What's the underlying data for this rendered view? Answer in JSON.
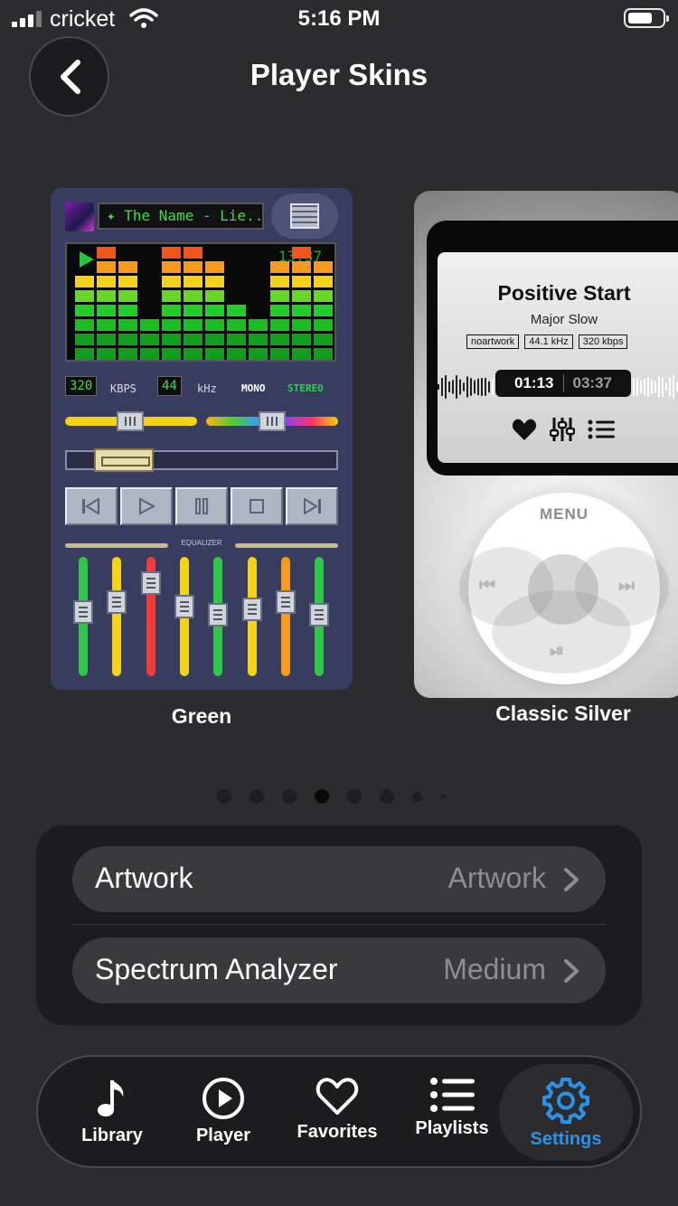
{
  "status_bar": {
    "carrier": "cricket",
    "time": "5:16 PM"
  },
  "header": {
    "title": "Player Skins"
  },
  "skins": [
    {
      "label": "Green",
      "track_display": "✦ The Name - Lie...",
      "time": "13:37",
      "bitrate": "320",
      "bitrate_unit": "KBPS",
      "sample_rate": "44",
      "sample_unit": "kHz",
      "mono_label": "MONO",
      "stereo_label": "STEREO",
      "equalizer_label": "EQUALIZER",
      "spectrum_levels": [
        6,
        8,
        7,
        3,
        8,
        8,
        7,
        4,
        3,
        7,
        8,
        7
      ],
      "volume": 0.32,
      "balance": 0.5,
      "seek": 0.15,
      "eq_levels": [
        0.55,
        0.65,
        0.85,
        0.6,
        0.52,
        0.58,
        0.65,
        0.52
      ],
      "eq_colors": [
        "#2fc64a",
        "#f5d21a",
        "#ef3b3b",
        "#f5d21a",
        "#2fc64a",
        "#f5d21a",
        "#f79a1d",
        "#2fc64a"
      ],
      "transport": [
        "prev",
        "play",
        "pause",
        "stop",
        "next"
      ]
    },
    {
      "label": "Classic Silver",
      "track_title": "Positive Start",
      "artist": "Major Slow",
      "tags": [
        "noartwork",
        "44.1 kHz",
        "320 kbps"
      ],
      "current_time": "01:13",
      "total_time": "03:37",
      "menu_label": "MENU",
      "icons": [
        "heart-icon",
        "equalizer-icon",
        "list-icon"
      ]
    }
  ],
  "pager": {
    "count": 8,
    "active_index": 3
  },
  "settings": [
    {
      "label": "Artwork",
      "value": "Artwork"
    },
    {
      "label": "Spectrum Analyzer",
      "value": "Medium"
    }
  ],
  "tabbar": {
    "active_color": "#2a93e8",
    "tabs": [
      {
        "label": "Library",
        "icon": "music-note-icon"
      },
      {
        "label": "Player",
        "icon": "play-circle-icon"
      },
      {
        "label": "Favorites",
        "icon": "heart-icon"
      },
      {
        "label": "Playlists",
        "icon": "list-icon"
      },
      {
        "label": "Settings",
        "icon": "gear-icon",
        "active": true
      }
    ]
  }
}
